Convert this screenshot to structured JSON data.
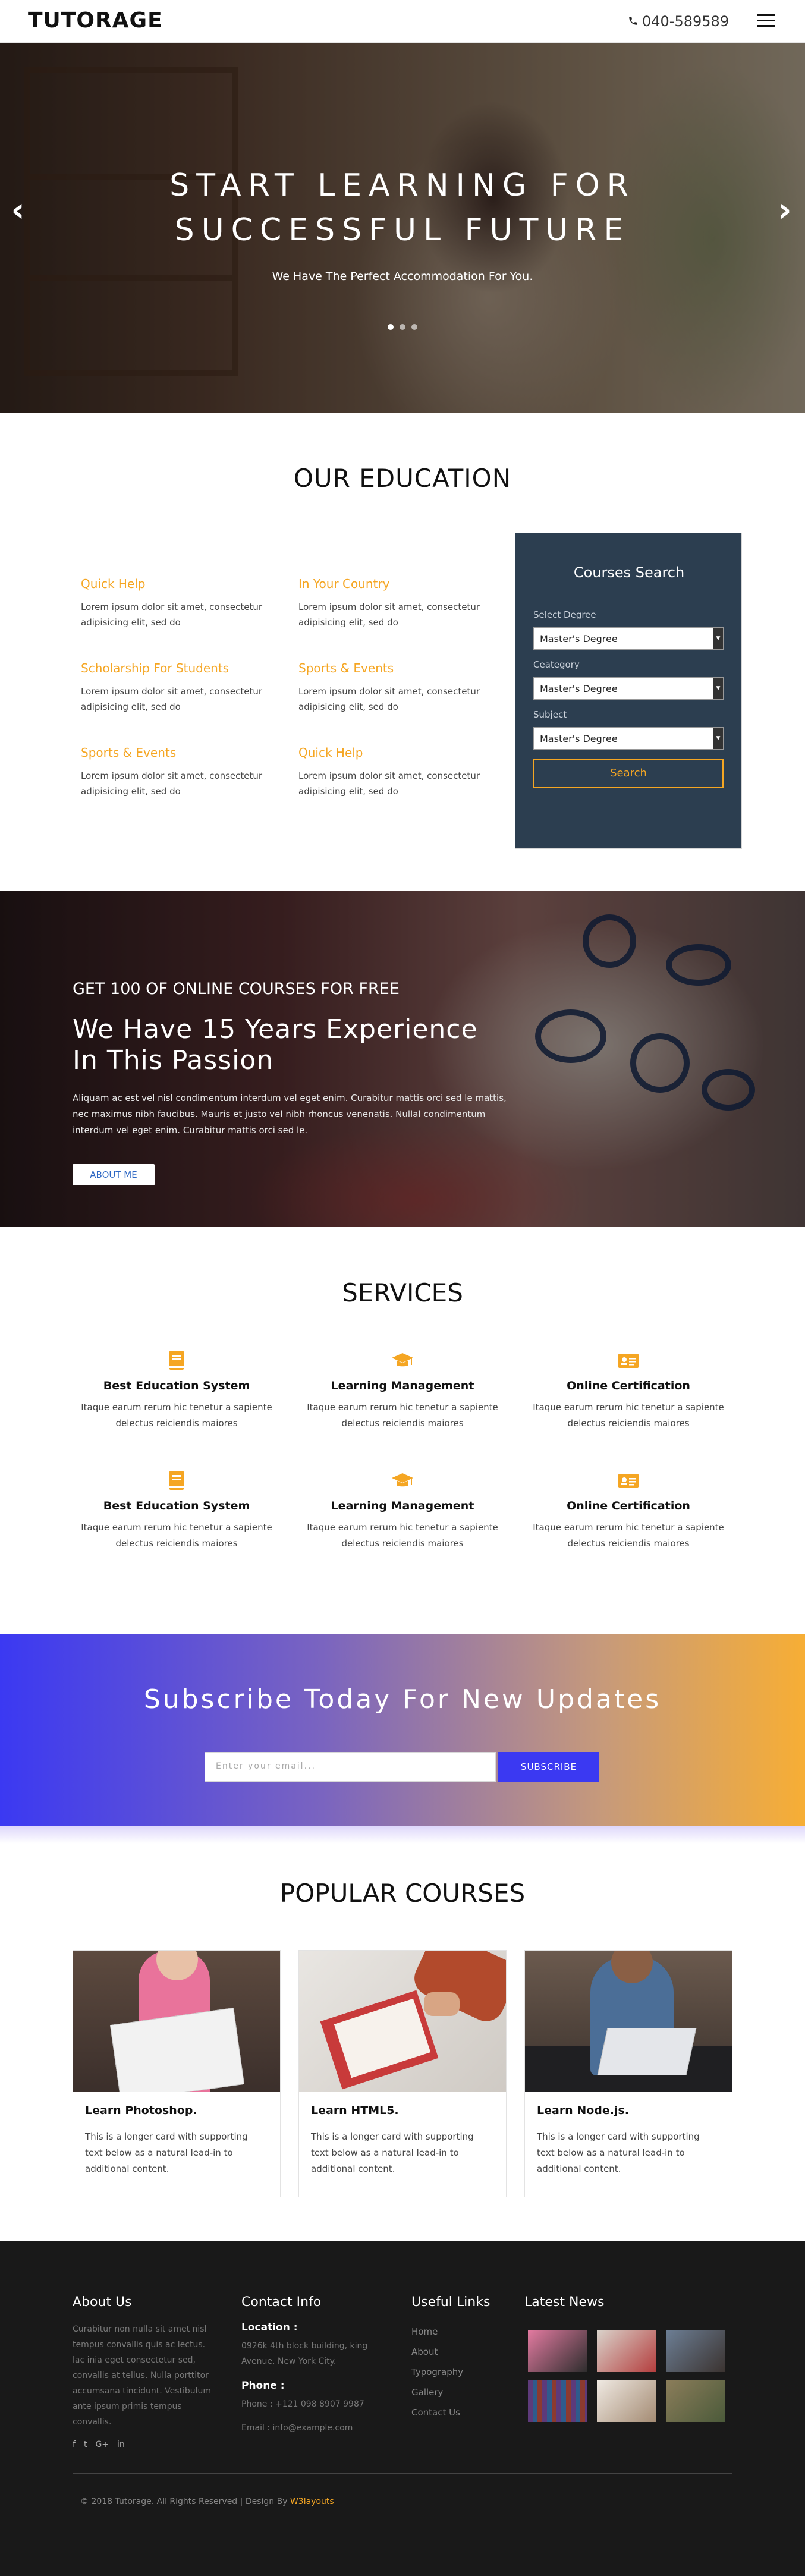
{
  "header": {
    "logo": "TUTORAGE",
    "phone": "040-589589",
    "phone_icon": "phone-icon",
    "menu_icon": "hamburger-icon"
  },
  "hero": {
    "title_line1": "START LEARNING FOR",
    "title_line2": "SUCCESSFUL FUTURE",
    "subtitle": "We Have The Perfect Accommodation For You.",
    "prev": "‹",
    "next": "›",
    "slides": 3,
    "active_slide": 1
  },
  "education": {
    "title": "OUR EDUCATION",
    "items": [
      {
        "title": "Quick Help",
        "text": "Lorem ipsum dolor sit amet, consectetur adipisicing elit, sed do"
      },
      {
        "title": "In Your Country",
        "text": "Lorem ipsum dolor sit amet, consectetur adipisicing elit, sed do"
      },
      {
        "title": "Scholarship For Students",
        "text": "Lorem ipsum dolor sit amet, consectetur adipisicing elit, sed do"
      },
      {
        "title": "Sports & Events",
        "text": "Lorem ipsum dolor sit amet, consectetur adipisicing elit, sed do"
      },
      {
        "title": "Sports & Events",
        "text": "Lorem ipsum dolor sit amet, consectetur adipisicing elit, sed do"
      },
      {
        "title": "Quick Help",
        "text": "Lorem ipsum dolor sit amet, consectetur adipisicing elit, sed do"
      }
    ]
  },
  "course_search": {
    "title": "Courses Search",
    "degree_label": "Select Degree",
    "degree_value": "Master's Degree",
    "category_label": "Ceategory",
    "category_value": "Master's Degree",
    "subject_label": "Subject",
    "subject_value": "Master's Degree",
    "button": "Search",
    "caret": "▼"
  },
  "experience": {
    "small": "GET 100 OF ONLINE COURSES FOR FREE",
    "big_line1": "We Have 15 Years Experience",
    "big_line2": "In This Passion",
    "text": "Aliquam ac est vel nisl condimentum interdum vel eget enim. Curabitur mattis orci sed le mattis, nec maximus nibh faucibus. Mauris et justo vel nibh rhoncus venenatis. Nullal condimentum interdum vel eget enim. Curabitur mattis orci sed le.",
    "button": "ABOUT ME"
  },
  "services": {
    "title": "SERVICES",
    "items": [
      {
        "icon": "book-icon",
        "title": "Best Education System",
        "text": "Itaque earum rerum hic tenetur a sapiente delectus reiciendis maiores"
      },
      {
        "icon": "graduation-cap-icon",
        "title": "Learning Management",
        "text": "Itaque earum rerum hic tenetur a sapiente delectus reiciendis maiores"
      },
      {
        "icon": "id-card-icon",
        "title": "Online Certification",
        "text": "Itaque earum rerum hic tenetur a sapiente delectus reiciendis maiores"
      },
      {
        "icon": "book-icon",
        "title": "Best Education System",
        "text": "Itaque earum rerum hic tenetur a sapiente delectus reiciendis maiores"
      },
      {
        "icon": "graduation-cap-icon",
        "title": "Learning Management",
        "text": "Itaque earum rerum hic tenetur a sapiente delectus reiciendis maiores"
      },
      {
        "icon": "id-card-icon",
        "title": "Online Certification",
        "text": "Itaque earum rerum hic tenetur a sapiente delectus reiciendis maiores"
      }
    ]
  },
  "subscribe": {
    "title": "Subscribe Today For New Updates",
    "placeholder": "Enter your email...",
    "button": "SUBSCRIBE"
  },
  "courses": {
    "title": "POPULAR COURSES",
    "items": [
      {
        "title": "Learn Photoshop.",
        "text": "This is a longer card with supporting text below as a natural lead-in to additional content."
      },
      {
        "title": "Learn HTML5.",
        "text": "This is a longer card with supporting text below as a natural lead-in to additional content."
      },
      {
        "title": "Learn Node.js.",
        "text": "This is a longer card with supporting text below as a natural lead-in to additional content."
      }
    ]
  },
  "footer": {
    "about_title": "About Us",
    "about_text": "Curabitur non nulla sit amet nisl tempus convallis quis ac lectus. lac inia eget consectetur sed, convallis at tellus. Nulla porttitor accumsana tincidunt. Vestibulum ante ipsum primis tempus convallis.",
    "social": [
      "f",
      "t",
      "G+",
      "in"
    ],
    "contact_title": "Contact Info",
    "location_label": "Location :",
    "location_text": "0926k 4th block building, king Avenue, New York City.",
    "phone_label": "Phone :",
    "phone_text": "Phone : +121 098 8907 9987",
    "email_text": "Email : info@example.com",
    "links_title": "Useful Links",
    "links": [
      "Home",
      "About",
      "Typography",
      "Gallery",
      "Contact Us"
    ],
    "news_title": "Latest News",
    "copyright": "© 2018 Tutorage. All Rights Reserved | Design By",
    "designer": "W3layouts"
  },
  "colors": {
    "accent": "#f5a623",
    "navy": "#2c3e50",
    "blue": "#3b39f2",
    "footer_bg": "#191919"
  }
}
